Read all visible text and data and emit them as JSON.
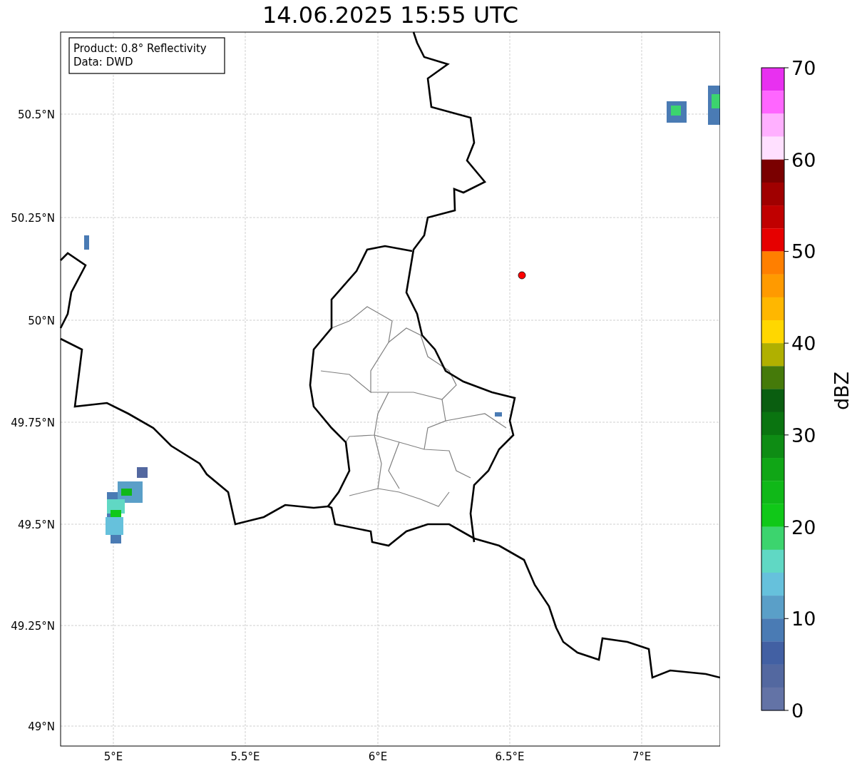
{
  "title": "14.06.2025 15:55 UTC",
  "info_box": [
    "Product: 0.8° Reflectivity",
    "Data: DWD"
  ],
  "x_axis": {
    "ticks": [
      "5°E",
      "5.5°E",
      "6°E",
      "6.5°E",
      "7°E"
    ]
  },
  "y_axis": {
    "ticks": [
      "50.5°N",
      "50.25°N",
      "50°N",
      "49.75°N",
      "49.5°N",
      "49.25°N",
      "49°N"
    ]
  },
  "colorbar": {
    "label": "dBZ",
    "ticks": [
      "70",
      "60",
      "50",
      "40",
      "30",
      "20",
      "10",
      "0"
    ],
    "segments": [
      {
        "color": "#e830f0"
      },
      {
        "color": "#ff66ff"
      },
      {
        "color": "#ffb0ff"
      },
      {
        "color": "#ffe0ff"
      },
      {
        "color": "#7a0000"
      },
      {
        "color": "#a00000"
      },
      {
        "color": "#c00000"
      },
      {
        "color": "#e60000"
      },
      {
        "color": "#ff7f00"
      },
      {
        "color": "#ff9a00"
      },
      {
        "color": "#ffb700"
      },
      {
        "color": "#ffd700"
      },
      {
        "color": "#b0b000"
      },
      {
        "color": "#457a0a"
      },
      {
        "color": "#0a5e10"
      },
      {
        "color": "#0a7410"
      },
      {
        "color": "#0e8c14"
      },
      {
        "color": "#10a616"
      },
      {
        "color": "#10b818"
      },
      {
        "color": "#10c818"
      },
      {
        "color": "#3cd46e"
      },
      {
        "color": "#60d8c4"
      },
      {
        "color": "#66c1dc"
      },
      {
        "color": "#5a9fc8"
      },
      {
        "color": "#4a7bb4"
      },
      {
        "color": "#4260a3"
      },
      {
        "color": "#5368a0"
      },
      {
        "color": "#6373a6"
      }
    ]
  }
}
